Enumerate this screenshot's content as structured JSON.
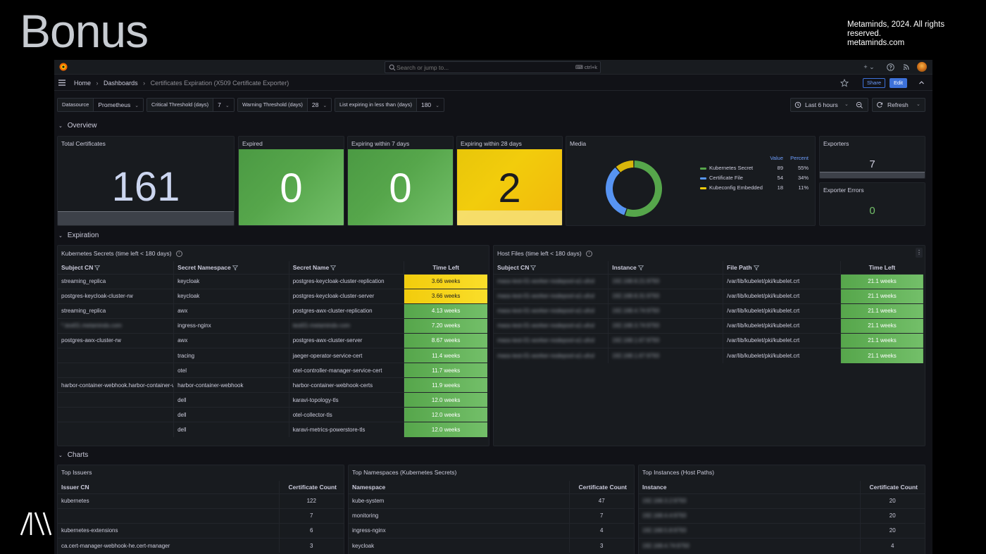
{
  "slide": {
    "title": "Bonus",
    "copyright_line1": "Metaminds, 2024. All rights reserved.",
    "copyright_line2": "metaminds.com"
  },
  "topbar": {
    "search_placeholder": "Search or jump to...",
    "search_shortcut": "⌨ ctrl+k",
    "plus_label": "+ ⌄"
  },
  "breadcrumb": {
    "home": "Home",
    "dashboards": "Dashboards",
    "current": "Certificates Expiration (X509 Certificate Exporter)"
  },
  "nav": {
    "share": "Share",
    "edit": "Edit"
  },
  "variables": [
    {
      "label": "Datasource",
      "value": "Prometheus"
    },
    {
      "label": "Critical Threshold (days)",
      "value": "7"
    },
    {
      "label": "Warning Threshold (days)",
      "value": "28"
    },
    {
      "label": "List expiring in less than (days)",
      "value": "180"
    }
  ],
  "timepicker": {
    "label": "Last 6 hours"
  },
  "refresh": {
    "label": "Refresh"
  },
  "rows": {
    "overview": "Overview",
    "expiration": "Expiration",
    "charts": "Charts"
  },
  "stats": {
    "total": {
      "title": "Total Certificates",
      "value": "161"
    },
    "expired": {
      "title": "Expired",
      "value": "0",
      "color": "#56a64b"
    },
    "exp7": {
      "title": "Expiring within 7 days",
      "value": "0",
      "color": "#56a64b"
    },
    "exp28": {
      "title": "Expiring within 28 days",
      "value": "2",
      "color": "#f2cc0c"
    },
    "exporters": {
      "title": "Exporters",
      "value": "7"
    },
    "exporter_errors": {
      "title": "Exporter Errors",
      "value": "0",
      "color": "#73bf69"
    }
  },
  "media": {
    "title": "Media",
    "value_header": "Value",
    "percent_header": "Percent",
    "items": [
      {
        "name": "Kubernetes Secret",
        "value": "89",
        "percent": "55%",
        "color": "#37872d"
      },
      {
        "name": "Certificate File",
        "value": "54",
        "percent": "34%",
        "color": "#1f60c4"
      },
      {
        "name": "Kubeconfig Embedded",
        "value": "18",
        "percent": "11%",
        "color": "#e0b400"
      }
    ]
  },
  "k8s_table": {
    "title": "Kubernetes Secrets (time left < 180 days)",
    "headers": [
      "Subject CN",
      "Secret Namespace",
      "Secret Name",
      "Time Left"
    ],
    "rows": [
      {
        "cn": "streaming_replica",
        "ns": "keycloak",
        "name": "postgres-keycloak-cluster-replication",
        "time": "3.66 weeks",
        "level": "warn"
      },
      {
        "cn": "postgres-keycloak-cluster-rw",
        "ns": "keycloak",
        "name": "postgres-keycloak-cluster-server",
        "time": "3.66 weeks",
        "level": "warn"
      },
      {
        "cn": "streaming_replica",
        "ns": "awx",
        "name": "postgres-awx-cluster-replication",
        "time": "4.13 weeks",
        "level": "ok"
      },
      {
        "cn": "*.test01.metaminds.com",
        "ns": "ingress-nginx",
        "name": "test01-metaminds-com",
        "time": "7.20 weeks",
        "level": "ok",
        "blur_cn": true,
        "blur_name": true
      },
      {
        "cn": "postgres-awx-cluster-rw",
        "ns": "awx",
        "name": "postgres-awx-cluster-server",
        "time": "8.67 weeks",
        "level": "ok"
      },
      {
        "cn": "",
        "ns": "tracing",
        "name": "jaeger-operator-service-cert",
        "time": "11.4 weeks",
        "level": "ok"
      },
      {
        "cn": "",
        "ns": "otel",
        "name": "otel-controller-manager-service-cert",
        "time": "11.7 weeks",
        "level": "ok"
      },
      {
        "cn": "harbor-container-webhook.harbor-container-webhook.svc",
        "ns": "harbor-container-webhook",
        "name": "harbor-container-webhook-certs",
        "time": "11.9 weeks",
        "level": "ok"
      },
      {
        "cn": "",
        "ns": "dell",
        "name": "karavi-topology-tls",
        "time": "12.0 weeks",
        "level": "ok"
      },
      {
        "cn": "",
        "ns": "dell",
        "name": "otel-collector-tls",
        "time": "12.0 weeks",
        "level": "ok"
      },
      {
        "cn": "",
        "ns": "dell",
        "name": "karavi-metrics-powerstore-tls",
        "time": "12.0 weeks",
        "level": "ok"
      }
    ]
  },
  "host_table": {
    "title": "Host Files (time left < 180 days)",
    "headers": [
      "Subject CN",
      "Instance",
      "File Path",
      "Time Left"
    ],
    "rows": [
      {
        "cn": "mass-test-01-worker-nodepool-a1-ufcd",
        "inst": "192.168.8.21:9793",
        "path": "/var/lib/kubelet/pki/kubelet.crt",
        "time": "21.1 weeks"
      },
      {
        "cn": "mass-test-01-worker-nodepool-a1-ufcd",
        "inst": "192.168.8.31:9793",
        "path": "/var/lib/kubelet/pki/kubelet.crt",
        "time": "21.1 weeks"
      },
      {
        "cn": "mass-test-01-worker-nodepool-a1-ufcd",
        "inst": "192.168.4.74:9793",
        "path": "/var/lib/kubelet/pki/kubelet.crt",
        "time": "21.1 weeks"
      },
      {
        "cn": "mass-test-01-worker-nodepool-a1-ufcd",
        "inst": "192.168.3.74:9793",
        "path": "/var/lib/kubelet/pki/kubelet.crt",
        "time": "21.1 weeks"
      },
      {
        "cn": "mass-test-01-worker-nodepool-a1-ufcd",
        "inst": "192.168.1.67:9793",
        "path": "/var/lib/kubelet/pki/kubelet.crt",
        "time": "21.1 weeks"
      },
      {
        "cn": "mass-test-01-worker-nodepool-a1-ufcd",
        "inst": "192.168.1.67:9793",
        "path": "/var/lib/kubelet/pki/kubelet.crt",
        "time": "21.1 weeks"
      }
    ]
  },
  "top_issuers": {
    "title": "Top Issuers",
    "headers": [
      "Issuer CN",
      "Certificate Count"
    ],
    "rows": [
      {
        "name": "kubernetes",
        "count": "122"
      },
      {
        "name": "",
        "count": "7"
      },
      {
        "name": "kubernetes-extensions",
        "count": "6"
      },
      {
        "name": "ca.cert-manager-webhook-he.cert-manager",
        "count": "3"
      }
    ]
  },
  "top_namespaces": {
    "title": "Top Namespaces (Kubernetes Secrets)",
    "headers": [
      "Namespace",
      "Certificate Count"
    ],
    "rows": [
      {
        "name": "kube-system",
        "count": "47"
      },
      {
        "name": "monitoring",
        "count": "7"
      },
      {
        "name": "ingress-nginx",
        "count": "4"
      },
      {
        "name": "keycloak",
        "count": "3"
      }
    ]
  },
  "top_instances": {
    "title": "Top Instances (Host Paths)",
    "headers": [
      "Instance",
      "Certificate Count"
    ],
    "rows": [
      {
        "name": "192.168.3.2:9793",
        "count": "20"
      },
      {
        "name": "192.168.4.4:9793",
        "count": "20"
      },
      {
        "name": "192.168.5.8:9793",
        "count": "20"
      },
      {
        "name": "192.168.4.74:9793",
        "count": "4"
      }
    ]
  }
}
